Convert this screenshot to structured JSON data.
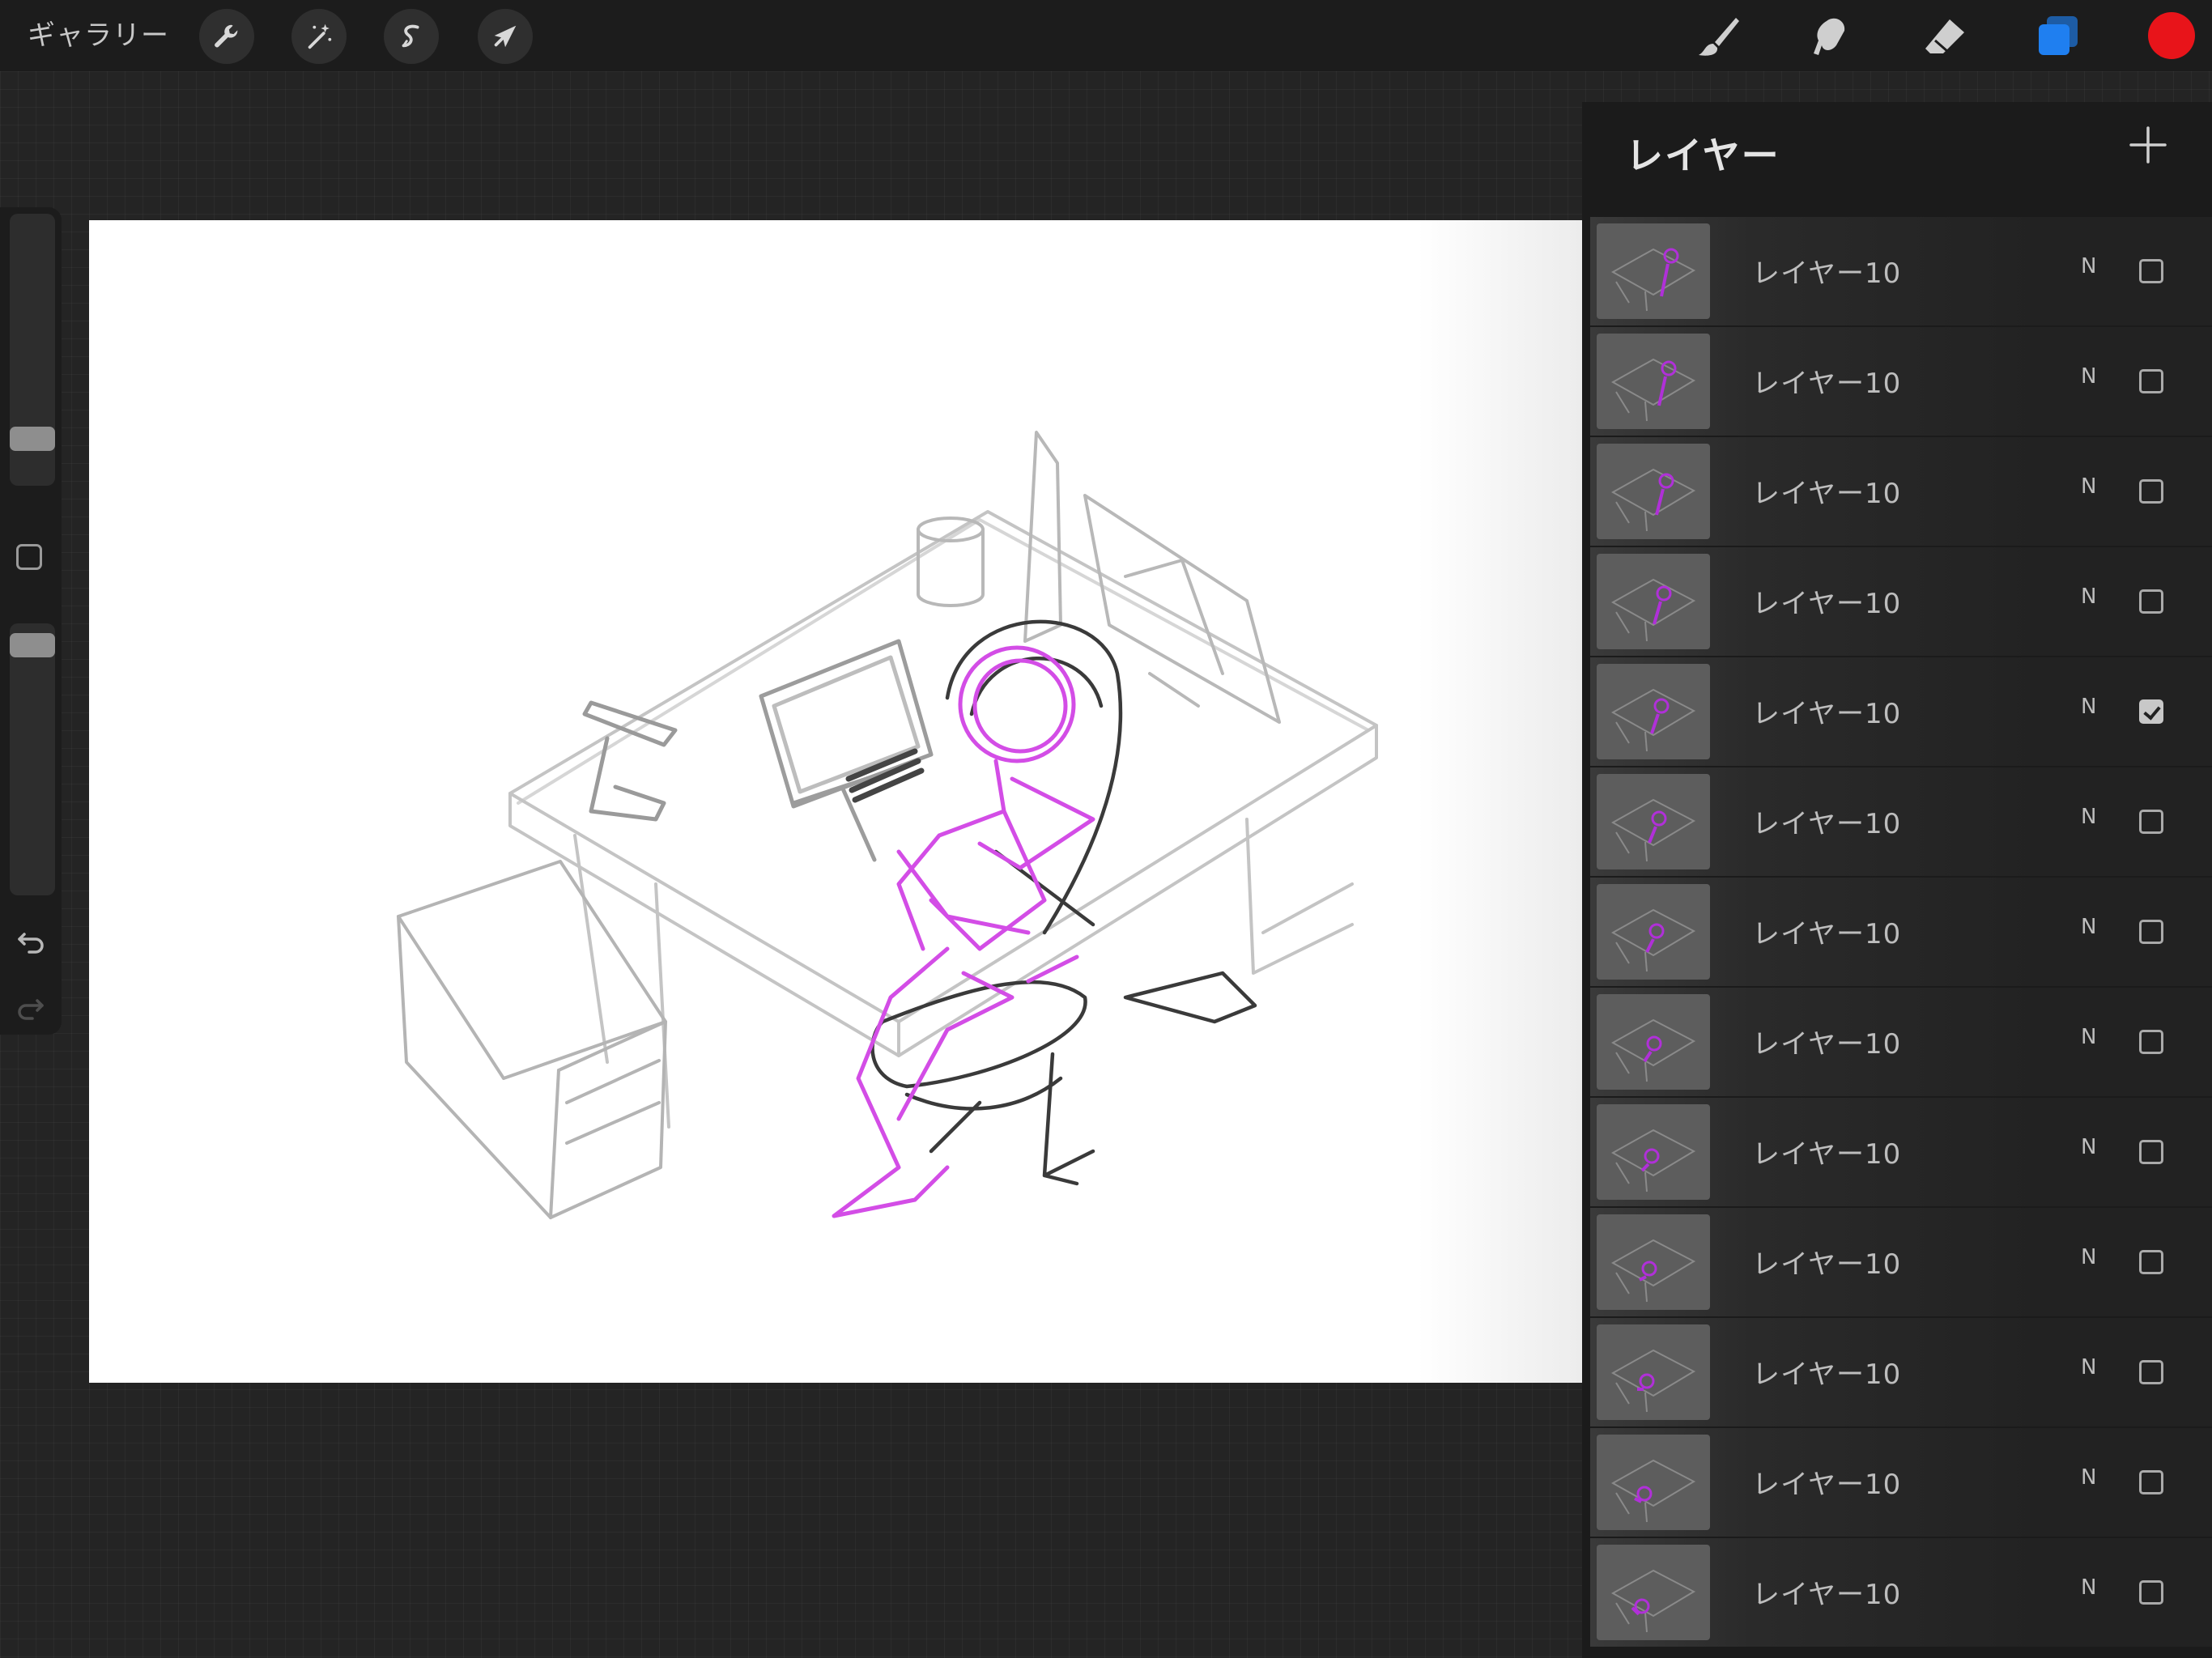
{
  "topbar": {
    "gallery_label": "ギャラリー",
    "left_tools": [
      {
        "icon": "wrench-icon",
        "name": "actions"
      },
      {
        "icon": "magic-wand-icon",
        "name": "adjustments"
      },
      {
        "icon": "selection-icon",
        "name": "selection"
      },
      {
        "icon": "arrow-cursor-icon",
        "name": "transform"
      }
    ],
    "right_tools": [
      {
        "icon": "brush-icon",
        "name": "paint"
      },
      {
        "icon": "smudge-icon",
        "name": "smudge"
      },
      {
        "icon": "eraser-icon",
        "name": "eraser"
      },
      {
        "icon": "layers-icon",
        "name": "layers",
        "active": true
      }
    ],
    "current_color": "#e8141a",
    "layers_active_color": "#1f7ff0"
  },
  "sidebar": {
    "brush_size_level": 0.12,
    "opacity_level": 0.96,
    "undo_icon": "undo-icon",
    "redo_icon": "redo-icon"
  },
  "layers_panel": {
    "title": "レイヤー",
    "add_icon": "plus-icon",
    "layers": [
      {
        "name": "レイヤー10",
        "mode": "N",
        "visible": false
      },
      {
        "name": "レイヤー10",
        "mode": "N",
        "visible": false
      },
      {
        "name": "レイヤー10",
        "mode": "N",
        "visible": false
      },
      {
        "name": "レイヤー10",
        "mode": "N",
        "visible": false
      },
      {
        "name": "レイヤー10",
        "mode": "N",
        "visible": true
      },
      {
        "name": "レイヤー10",
        "mode": "N",
        "visible": false
      },
      {
        "name": "レイヤー10",
        "mode": "N",
        "visible": false
      },
      {
        "name": "レイヤー10",
        "mode": "N",
        "visible": false
      },
      {
        "name": "レイヤー10",
        "mode": "N",
        "visible": false
      },
      {
        "name": "レイヤー10",
        "mode": "N",
        "visible": false
      },
      {
        "name": "レイヤー10",
        "mode": "N",
        "visible": false
      },
      {
        "name": "レイヤー10",
        "mode": "N",
        "visible": false
      },
      {
        "name": "レイヤー10",
        "mode": "N",
        "visible": false
      }
    ]
  }
}
